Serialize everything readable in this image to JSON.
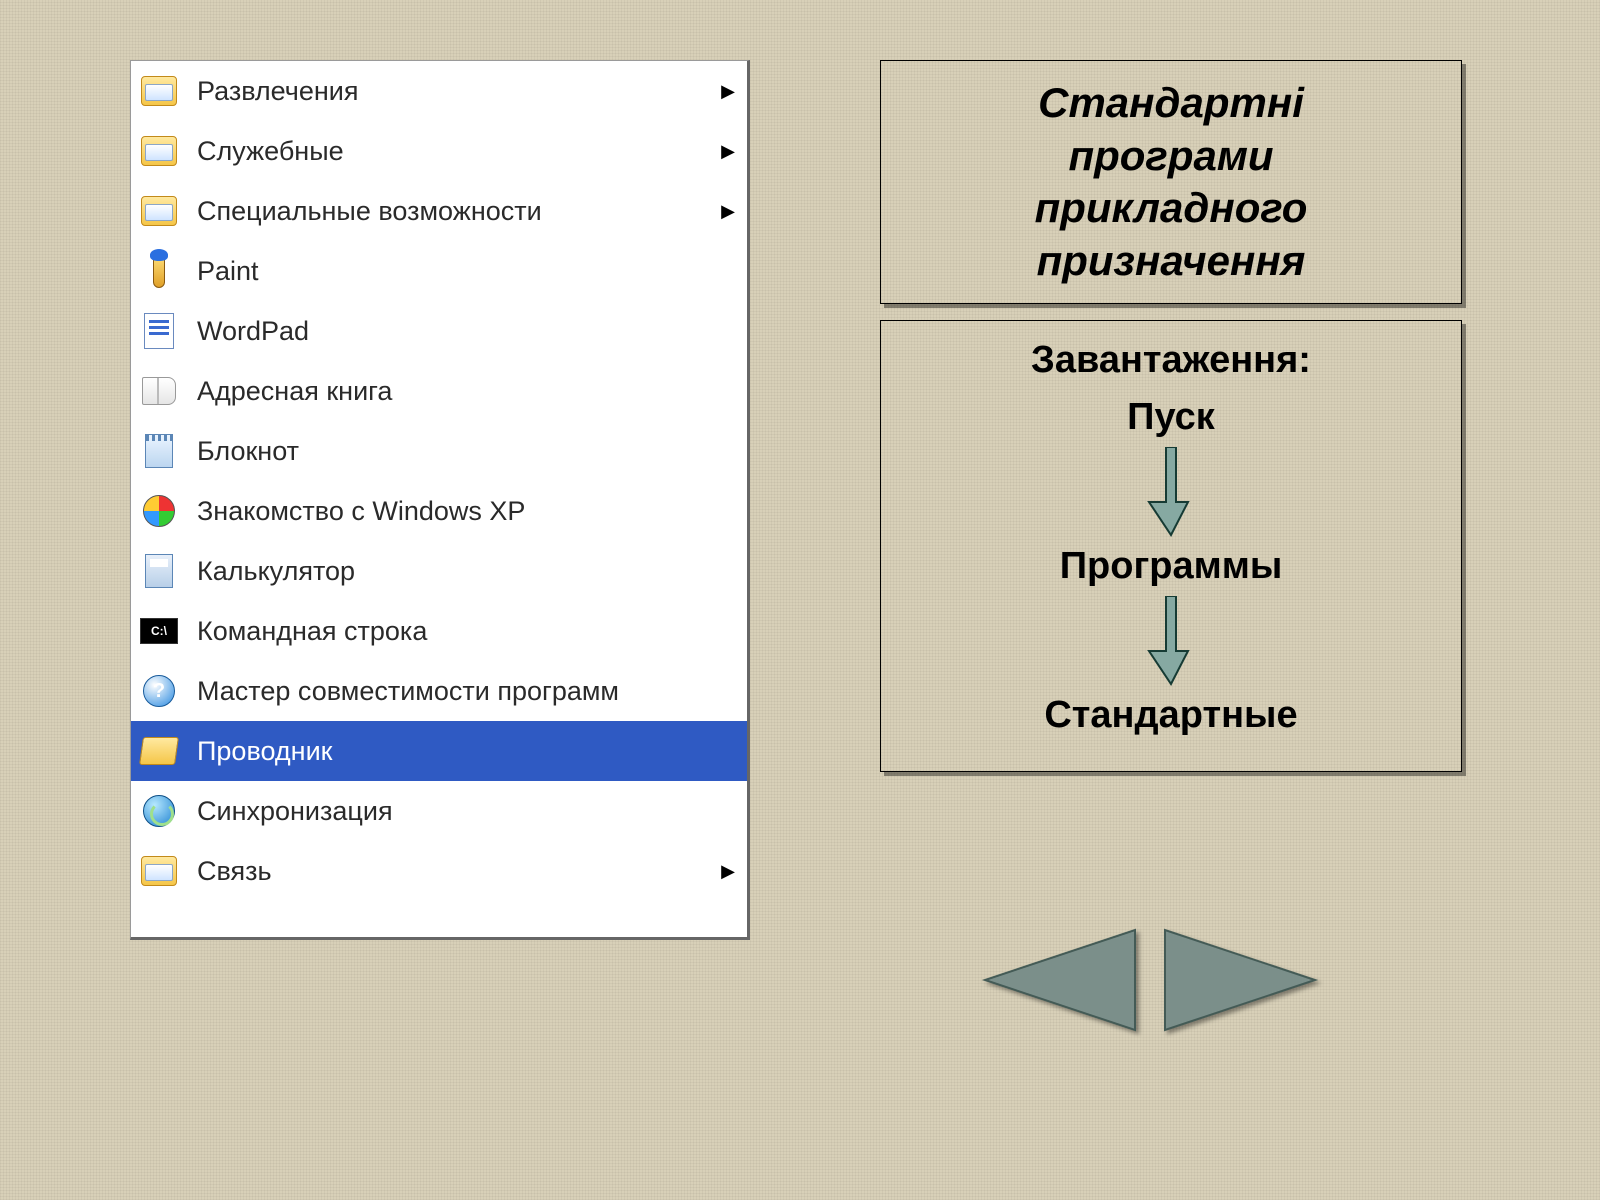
{
  "menu": {
    "items": [
      {
        "label": "Развлечения",
        "icon": "folder",
        "submenu": true
      },
      {
        "label": "Служебные",
        "icon": "folder",
        "submenu": true
      },
      {
        "label": "Специальные возможности",
        "icon": "folder",
        "submenu": true
      },
      {
        "label": "Paint",
        "icon": "paint",
        "submenu": false
      },
      {
        "label": "WordPad",
        "icon": "wordpad",
        "submenu": false
      },
      {
        "label": "Адресная книга",
        "icon": "book",
        "submenu": false
      },
      {
        "label": "Блокнот",
        "icon": "notepad",
        "submenu": false
      },
      {
        "label": "Знакомство с Windows XP",
        "icon": "winxp",
        "submenu": false
      },
      {
        "label": "Калькулятор",
        "icon": "calc",
        "submenu": false
      },
      {
        "label": "Командная строка",
        "icon": "cmd",
        "submenu": false
      },
      {
        "label": "Мастер совместимости программ",
        "icon": "help",
        "submenu": false
      },
      {
        "label": "Проводник",
        "icon": "folder-open",
        "submenu": false,
        "selected": true
      },
      {
        "label": "Синхронизация",
        "icon": "sync",
        "submenu": false
      },
      {
        "label": "Связь",
        "icon": "folder",
        "submenu": true
      }
    ]
  },
  "box1": {
    "line1": "Стандартні",
    "line2": "програми",
    "line3": "прикладного",
    "line4": "призначення"
  },
  "box2": {
    "header": "Завантаження:",
    "step1": "Пуск",
    "step2": "Программы",
    "step3": "Стандартные"
  },
  "colors": {
    "arrow_fill": "#86a9a2",
    "arrow_stroke": "#163b34",
    "nav_fill": "#7b8f8a",
    "nav_stroke": "#445b56"
  }
}
